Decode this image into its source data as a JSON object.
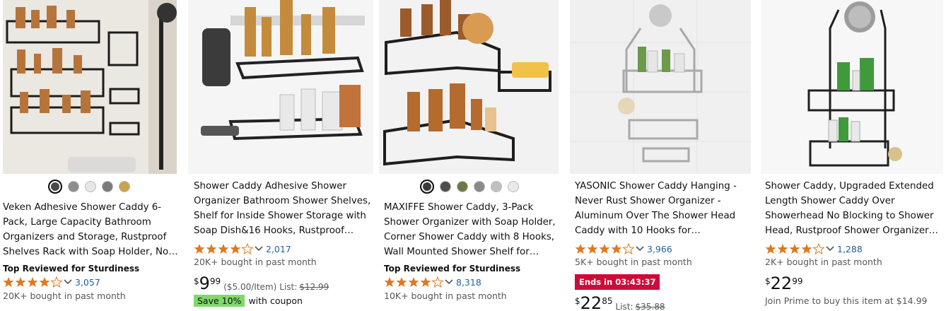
{
  "products": [
    {
      "title": "Veken Adhesive Shower Caddy 6-Pack, Large Capacity Bathroom Organizers and Storage, Rustproof Shelves Rack with Soap Holder, No…",
      "tag": "Top Reviewed for Sturdiness",
      "rating": 4.5,
      "rating_count": "3,057",
      "bought": "20K+ bought in past month",
      "swatches": [
        "#4a4a4a",
        "#8c8c8c",
        "#e6e6e6",
        "#7a7a7a",
        "#c9a44a"
      ],
      "selected_swatch": 0
    },
    {
      "title": "Shower Caddy Adhesive Shower Organizer Bathroom Shower Shelves, Shelf for Inside Shower Storage with Soap Dish&16 Hooks, Rustproof…",
      "rating": 4.5,
      "rating_count": "2,017",
      "bought": "20K+ bought in past month",
      "price_currency": "$",
      "price_whole": "9",
      "price_fraction": "99",
      "unit_price": "($5.00/Item)",
      "list_label": "List:",
      "list_price": "$12.99",
      "coupon_badge": "Save 10%",
      "coupon_text": "with coupon"
    },
    {
      "title": "MAXIFFE Shower Caddy, 3-Pack Shower Organizer with Soap Holder, Corner Shower Caddy with 8 Hooks, Wall Mounted Shower Shelf for…",
      "tag": "Top Reviewed for Sturdiness",
      "rating": 4.5,
      "rating_count": "8,318",
      "bought": "10K+ bought in past month",
      "swatches": [
        "#3a3a3a",
        "#4d4d4d",
        "#6b7a45",
        "#8a8a8a",
        "#bfbfbf",
        "#e9e9e9"
      ],
      "selected_swatch": 0
    },
    {
      "title": "YASONIC Shower Caddy Hanging - Never Rust Shower Organizer - Aluminum Over The Shower Head Caddy with 10 Hooks for…",
      "rating": 4.5,
      "rating_count": "3,966",
      "bought": "5K+ bought in past month",
      "deal_badge": "Ends in 03:43:37",
      "price_currency": "$",
      "price_whole": "22",
      "price_fraction": "85",
      "list_label": "List:",
      "list_price": "$35.88"
    },
    {
      "title": "Shower Caddy, Upgraded Extended Length Shower Caddy Over Showerhead No Blocking to Shower Head, Rustproof Shower Organizer…",
      "rating": 4.5,
      "rating_count": "1,288",
      "bought": "2K+ bought in past month",
      "price_currency": "$",
      "price_whole": "22",
      "price_fraction": "99",
      "prime_text": "Join Prime to buy this item at $14.99"
    }
  ],
  "colors": {
    "star": "#de7921",
    "link": "#2162a1",
    "deal": "#cc0c39",
    "coupon": "#7fda69"
  }
}
